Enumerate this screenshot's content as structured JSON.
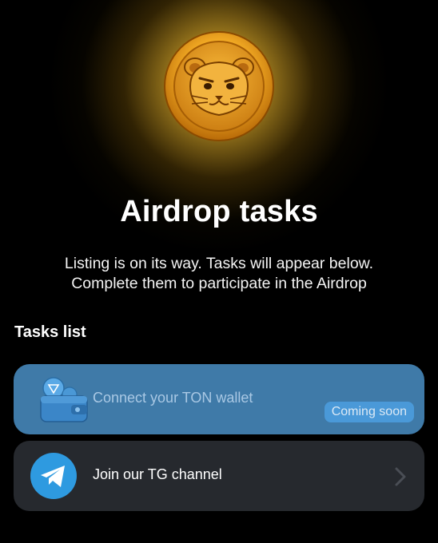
{
  "header": {
    "title": "Airdrop tasks",
    "subtitle_line1": "Listing is on its way. Tasks will appear below.",
    "subtitle_line2": "Complete them to participate in the Airdrop"
  },
  "tasks_section": {
    "title": "Tasks list",
    "items": [
      {
        "label": "Connect your TON wallet",
        "icon": "wallet-icon",
        "badge": "Coming soon",
        "status": "disabled"
      },
      {
        "label": "Join our TG channel",
        "icon": "telegram-icon",
        "action_icon": "chevron-right-icon"
      }
    ]
  },
  "colors": {
    "background": "#000000",
    "accent_gold": "#e8a21a",
    "ton_card": "#3f7aa8",
    "tg_card": "#26292e",
    "badge": "#4a99d8",
    "telegram_blue": "#2e9ae0"
  }
}
